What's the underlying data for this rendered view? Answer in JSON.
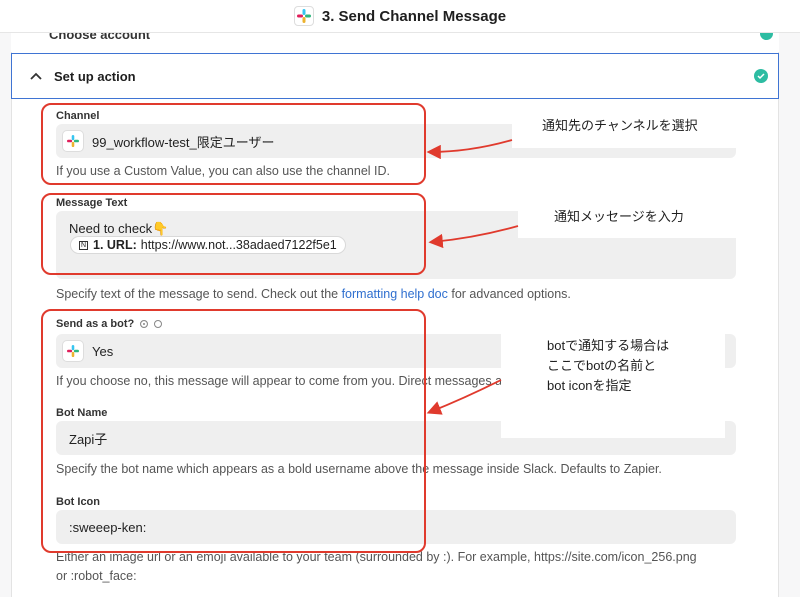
{
  "header": {
    "title": "3. Send Channel Message",
    "app_icon": "slack-icon"
  },
  "prev_section": {
    "label": "Choose account"
  },
  "section": {
    "label": "Set up action"
  },
  "channel": {
    "label": "Channel",
    "value": "99_workflow-test_限定ユーザー",
    "help": "If you use a Custom Value, you can also use the channel ID."
  },
  "message": {
    "label": "Message Text",
    "line1": "Need to check👇",
    "pill_prefix": "1. URL:",
    "pill_value": "https://www.not...38adaed7122f5e1",
    "help_before": "Specify text of the message to send. Check out the ",
    "help_link": "formatting help doc",
    "help_after": " for advanced options."
  },
  "bot": {
    "label": "Send as a bot?",
    "value": "Yes",
    "help": "If you choose no, this message will appear to come from you. Direct messages a"
  },
  "bot_name": {
    "label": "Bot Name",
    "value": "Zapi子",
    "help": "Specify the bot name which appears as a bold username above the message inside Slack. Defaults to Zapier."
  },
  "bot_icon": {
    "label": "Bot Icon",
    "value": ":sweeep-ken:",
    "help_line1": "Either an image url or an emoji available to your team (surrounded by :). For example, https://site.com/icon_256.png",
    "help_line2": "or :robot_face:"
  },
  "annotations": {
    "callout1": "通知先のチャンネルを選択",
    "callout2": "通知メッセージを入力",
    "callout3_line1": "botで通知する場合は",
    "callout3_line2": "ここでbotの名前と",
    "callout3_line3": "bot iconを指定"
  },
  "colors": {
    "accent": "#3f74d3",
    "success": "#2dbca2",
    "annotation": "#e03a2d",
    "link": "#2f6fcf"
  }
}
